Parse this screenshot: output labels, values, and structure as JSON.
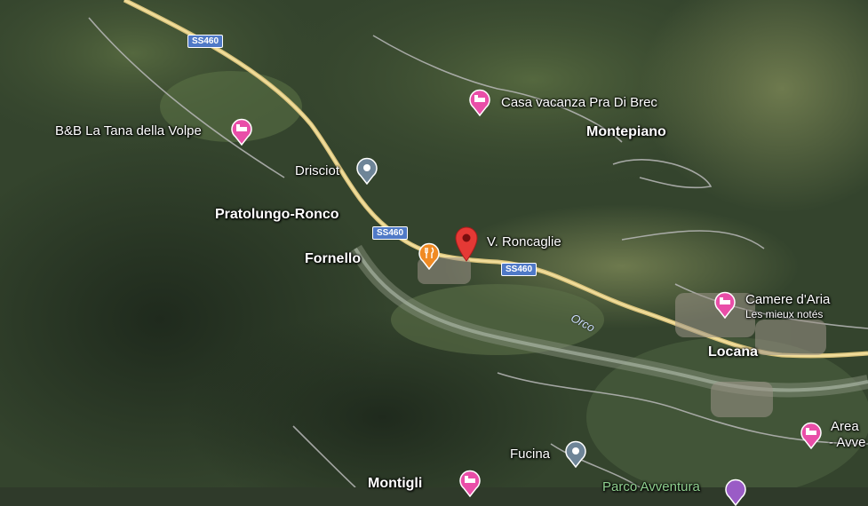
{
  "map": {
    "type": "satellite",
    "colors": {
      "road": "#e8d28c",
      "lodging": "#e94ea8",
      "restaurant": "#f08a24",
      "landmark": "#6e8598",
      "selected_pin": "#e53935",
      "route_shield": "#4f79c7"
    },
    "places": [
      {
        "name": "Pratolungo-Ronco"
      },
      {
        "name": "Fornello"
      },
      {
        "name": "Montepiano"
      },
      {
        "name": "Locana"
      },
      {
        "name": "Montigli"
      }
    ],
    "pois": [
      {
        "name": "B&B La Tana della Volpe",
        "icon": "bed-icon"
      },
      {
        "name": "Casa vacanza Pra Di Brec",
        "icon": "bed-icon"
      },
      {
        "name": "Drisciot",
        "icon": "landmark-icon"
      },
      {
        "name": "V. Roncaglie",
        "icon": "location-pin-icon"
      },
      {
        "name": "Camere d'Aria",
        "sub": "Les mieux notés",
        "icon": "bed-icon"
      },
      {
        "name": "Area",
        "sub": "- Avve",
        "icon": "bed-icon"
      },
      {
        "name": "Fucina",
        "icon": "landmark-icon"
      },
      {
        "name": "Parco Avventura",
        "icon": "attraction-icon"
      },
      {
        "name": "",
        "icon": "restaurant-icon"
      }
    ],
    "route_shields": [
      "SS460",
      "SS460",
      "SS460"
    ],
    "river": "Orco"
  }
}
